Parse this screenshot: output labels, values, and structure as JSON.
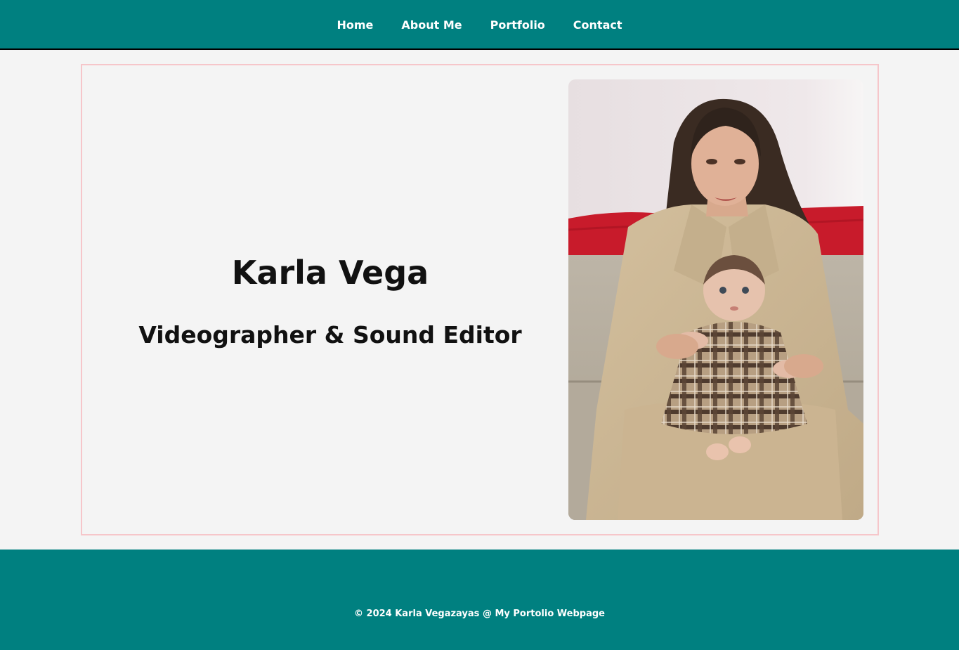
{
  "nav": {
    "items": [
      {
        "label": "Home"
      },
      {
        "label": "About Me"
      },
      {
        "label": "Portfolio"
      },
      {
        "label": "Contact"
      }
    ]
  },
  "hero": {
    "name": "Karla Vega",
    "role": "Videographer & Sound Editor"
  },
  "footer": {
    "text": "© 2024 Karla Vegazayas @ My Portolio Webpage"
  },
  "colors": {
    "brand_teal": "#008080",
    "page_background": "#f4f4f4",
    "hero_border": "#f6c6ca",
    "nav_text": "#ffffff"
  }
}
